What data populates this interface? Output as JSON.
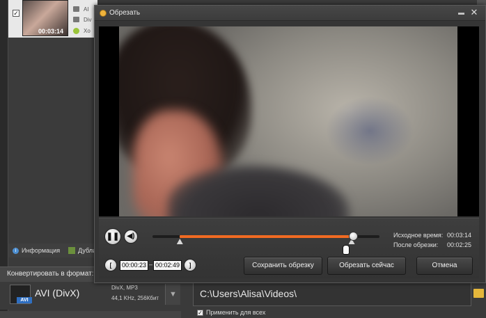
{
  "background": {
    "thumbnail_duration": "00:03:14",
    "tags": [
      "AI",
      "Div",
      "Xo"
    ],
    "info_tab": "Информация",
    "dup_tab": "Дубли",
    "convert_label": "Конвертировать в формат:",
    "format": {
      "name": "AVI (DivX)",
      "badge": "AVI",
      "detail1": "DivX, MP3",
      "detail2": "44,1 KHz, 256Кбит"
    },
    "output_path": "C:\\Users\\Alisa\\Videos\\",
    "apply_all": "Применить для всех"
  },
  "dialog": {
    "title": "Обрезать",
    "original_time_label": "Исходное время:",
    "original_time_value": "00:03:14",
    "after_trim_label": "После обрезки:",
    "after_trim_value": "00:02:25",
    "start_time": "00:00:23",
    "end_time": "00:02:49",
    "time_separator": "–",
    "save_trim_label": "Сохранить обрезку",
    "trim_now_label": "Обрезать сейчас",
    "cancel_label": "Отмена",
    "playhead_fraction": 0.886,
    "selection_start_fraction": 0.119,
    "selection_end_fraction": 0.876
  },
  "colors": {
    "accent": "#f06a22",
    "title_icon": "#f0b43c"
  }
}
